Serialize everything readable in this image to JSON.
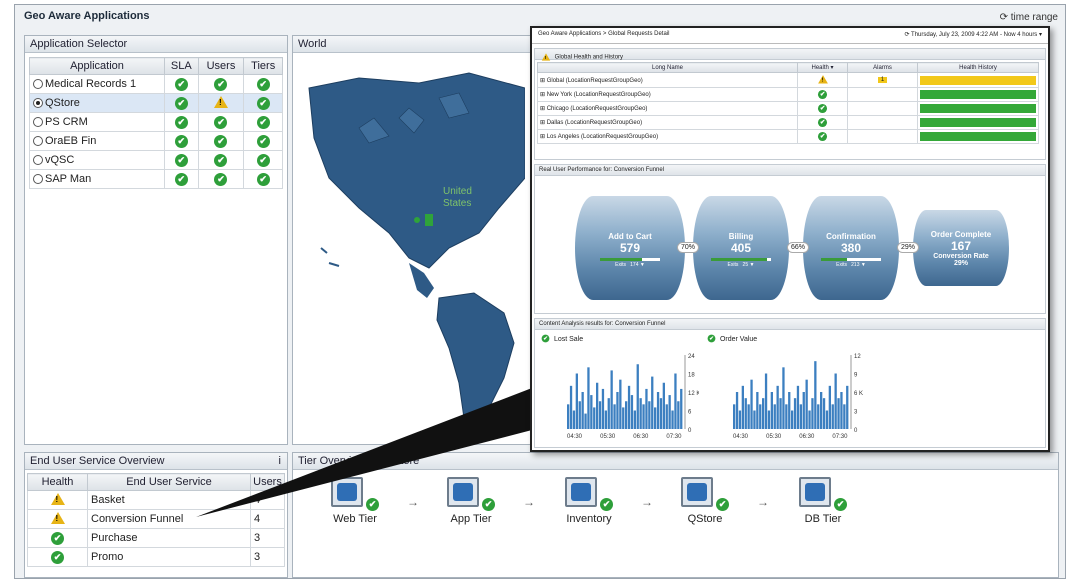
{
  "app": {
    "title": "Geo Aware Applications",
    "time_range": "⟳ time range"
  },
  "app_selector": {
    "title": "Application Selector",
    "columns": [
      "Application",
      "SLA",
      "Users",
      "Tiers"
    ],
    "rows": [
      {
        "name": "Medical Records 1",
        "selected": false,
        "sla": "ok",
        "users": "ok",
        "tiers": "ok"
      },
      {
        "name": "QStore",
        "selected": true,
        "sla": "ok",
        "users": "warn",
        "tiers": "ok"
      },
      {
        "name": "PS CRM",
        "selected": false,
        "sla": "ok",
        "users": "ok",
        "tiers": "ok"
      },
      {
        "name": "OraEB Fin",
        "selected": false,
        "sla": "ok",
        "users": "ok",
        "tiers": "ok"
      },
      {
        "name": "vQSC",
        "selected": false,
        "sla": "ok",
        "users": "ok",
        "tiers": "ok"
      },
      {
        "name": "SAP Man",
        "selected": false,
        "sla": "ok",
        "users": "ok",
        "tiers": "ok"
      }
    ]
  },
  "world": {
    "title": "World",
    "marker_label": "United\nStates"
  },
  "eus_overview": {
    "title": "End User Service Overview",
    "info": "i",
    "columns": [
      "Health",
      "End User Service",
      "Users"
    ],
    "rows": [
      {
        "health": "warn",
        "service": "Basket",
        "users": "4"
      },
      {
        "health": "warn",
        "service": "Conversion Funnel",
        "users": "4"
      },
      {
        "health": "ok",
        "service": "Purchase",
        "users": "3"
      },
      {
        "health": "ok",
        "service": "Promo",
        "users": "3"
      }
    ]
  },
  "tier_overview": {
    "title": "Tier Overview for QStore",
    "tiers": [
      {
        "label": "Web Tier",
        "icon": "globe-icon"
      },
      {
        "label": "App Tier",
        "icon": "window-icon"
      },
      {
        "label": "Inventory",
        "icon": "shield-icon"
      },
      {
        "label": "QStore",
        "icon": "shield-icon"
      },
      {
        "label": "DB Tier",
        "icon": "database-icon"
      }
    ]
  },
  "detail": {
    "breadcrumb": "Geo Aware Applications > Global Requests Detail",
    "timestamp": "⟳ Thursday, July 23, 2009 4:22 AM - Now 4 hours ▾",
    "health_section": {
      "title": "Global Health and History",
      "columns": [
        "Long Name",
        "Health ▾",
        "Alarms",
        "Health History"
      ],
      "rows": [
        {
          "name": "⊞ Global (LocationRequestGroupGeo)",
          "health": "warn",
          "alarm": "1",
          "history_color": "#f2c81a"
        },
        {
          "name": "⊞ New York (LocationRequestGroupGeo)",
          "health": "ok",
          "alarm": "",
          "history_color": "#34a838"
        },
        {
          "name": "⊞ Chicago (LocationRequestGroupGeo)",
          "health": "ok",
          "alarm": "",
          "history_color": "#34a838"
        },
        {
          "name": "⊞ Dallas (LocationRequestGroupGeo)",
          "health": "ok",
          "alarm": "",
          "history_color": "#34a838"
        },
        {
          "name": "⊞ Los Angeles (LocationRequestGroupGeo)",
          "health": "ok",
          "alarm": "",
          "history_color": "#34a838"
        }
      ]
    },
    "funnel_section": {
      "title": "Real User Performance for: Conversion Funnel",
      "stages": [
        {
          "name": "Add to Cart",
          "value": "579",
          "exits_label": "Exits",
          "exits": "174 ▼",
          "fill": 0.7
        },
        {
          "name": "Billing",
          "value": "405",
          "exits_label": "Exits",
          "exits": "25 ▼",
          "fill": 0.94
        },
        {
          "name": "Confirmation",
          "value": "380",
          "exits_label": "Exits",
          "exits": "213 ▼",
          "fill": 0.44
        },
        {
          "name": "Order Complete",
          "value": "167",
          "rate_label": "Conversion Rate",
          "rate": "29%"
        }
      ],
      "conversions": [
        "70%",
        "66%",
        "29%"
      ]
    },
    "content_section": {
      "title": "Content Analysis results for: Conversion Funnel",
      "charts": [
        {
          "legend": "Lost Sale",
          "x_ticks": [
            "04:30",
            "05:30",
            "06:30",
            "07:30"
          ],
          "y_ticks": [
            "24",
            "18",
            "12 K",
            "6",
            "0"
          ]
        },
        {
          "legend": "Order Value",
          "x_ticks": [
            "04:30",
            "05:30",
            "06:30",
            "07:30"
          ],
          "y_ticks": [
            "12",
            "9",
            "6 K",
            "3",
            "0"
          ]
        }
      ]
    }
  },
  "chart_data": [
    {
      "type": "bar",
      "title": "Lost Sale",
      "ylabel": "K",
      "ylim": [
        0,
        24
      ],
      "values": [
        8,
        14,
        6,
        18,
        9,
        12,
        5,
        20,
        11,
        7,
        15,
        9,
        13,
        6,
        10,
        19,
        8,
        12,
        16,
        7,
        9,
        14,
        11,
        6,
        21,
        10,
        8,
        13,
        9,
        17,
        7,
        12,
        10,
        15,
        8,
        11,
        6,
        18,
        9,
        13
      ]
    },
    {
      "type": "bar",
      "title": "Order Value",
      "ylabel": "K",
      "ylim": [
        0,
        12
      ],
      "values": [
        4,
        6,
        3,
        7,
        5,
        4,
        8,
        3,
        6,
        4,
        5,
        9,
        3,
        6,
        4,
        7,
        5,
        10,
        4,
        6,
        3,
        5,
        7,
        4,
        6,
        8,
        3,
        5,
        11,
        4,
        6,
        5,
        3,
        7,
        4,
        9,
        5,
        6,
        4,
        7
      ]
    }
  ]
}
